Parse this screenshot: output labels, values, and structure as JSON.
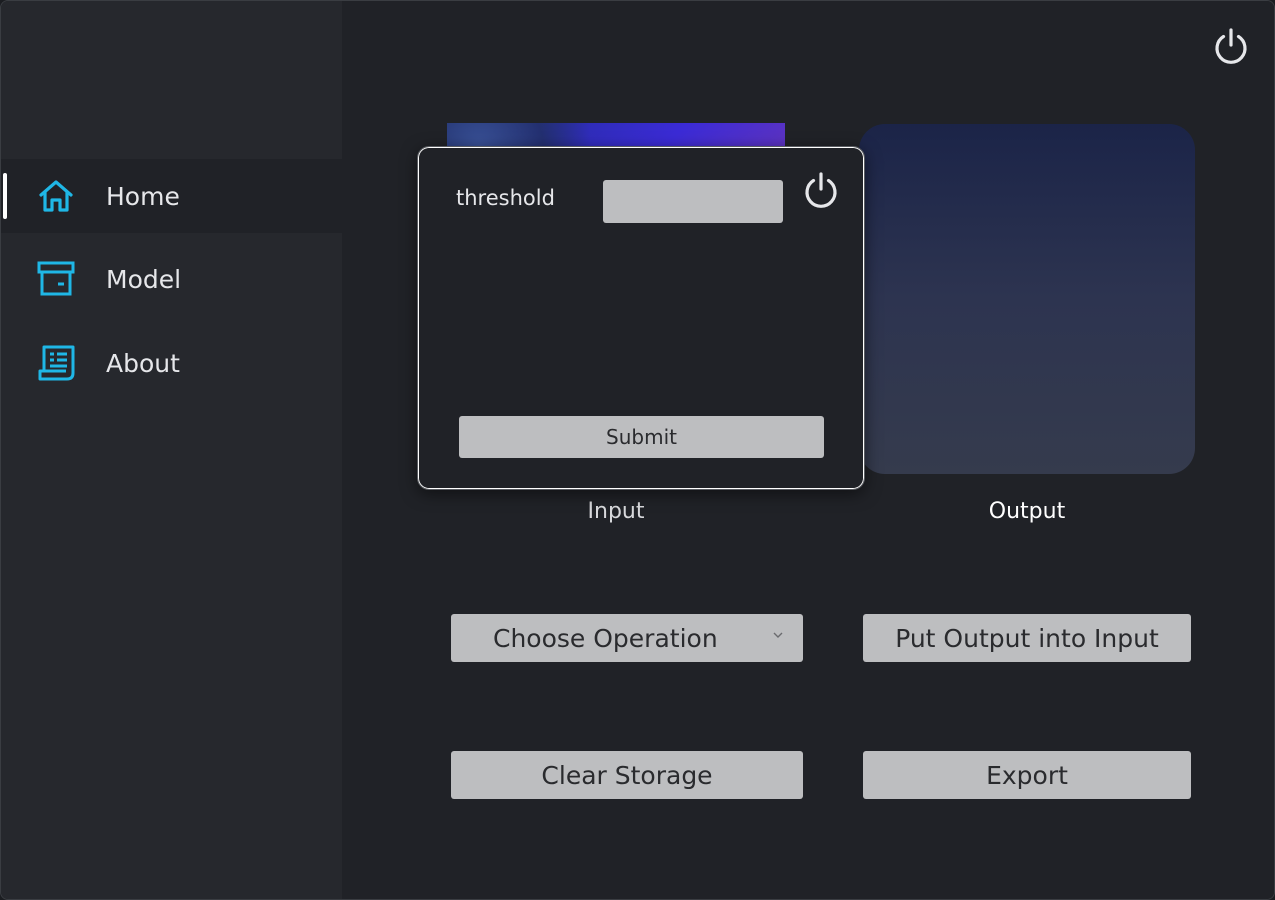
{
  "sidebar": {
    "items": [
      {
        "label": "Home",
        "icon": "home-icon",
        "active": true
      },
      {
        "label": "Model",
        "icon": "archive-icon",
        "active": false
      },
      {
        "label": "About",
        "icon": "document-icon",
        "active": false
      }
    ]
  },
  "main": {
    "input_caption": "Input",
    "output_caption": "Output",
    "operation_select": {
      "value": "Choose Operation"
    },
    "put_output_label": "Put Output into Input",
    "clear_storage_label": "Clear Storage",
    "export_label": "Export",
    "power_icon": "power-icon"
  },
  "dialog": {
    "threshold_label": "threshold",
    "threshold_value": "",
    "submit_label": "Submit",
    "power_icon": "power-icon"
  },
  "colors": {
    "accent": "#1fb7e6",
    "sidebar_bg": "#26282d",
    "main_bg": "#202227",
    "button_bg": "#bdbec0"
  }
}
